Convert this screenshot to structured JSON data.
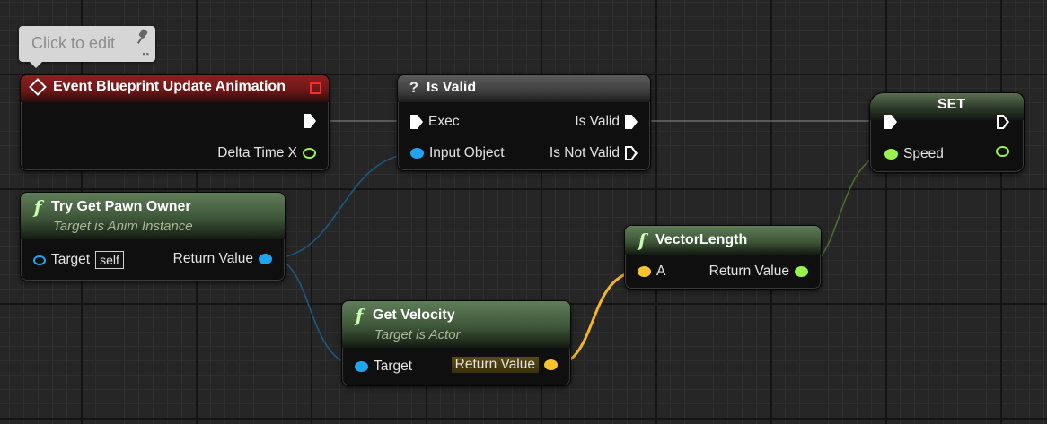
{
  "tooltip": {
    "text": "Click to edit"
  },
  "nodes": {
    "event": {
      "title": "Event Blueprint Update Animation",
      "output": "Delta Time X"
    },
    "is_valid": {
      "title": "Is Valid",
      "exec_in": "Exec",
      "input": "Input Object",
      "out_valid": "Is Valid",
      "out_not_valid": "Is Not Valid"
    },
    "try_get_pawn": {
      "title": "Try Get Pawn Owner",
      "subtitle": "Target is Anim Instance",
      "input": "Target",
      "input_default": "self",
      "output": "Return Value"
    },
    "get_velocity": {
      "title": "Get Velocity",
      "subtitle": "Target is Actor",
      "input": "Target",
      "output": "Return Value"
    },
    "vector_length": {
      "title": "VectorLength",
      "input": "A",
      "output": "Return Value"
    },
    "set": {
      "title": "SET",
      "input": "Speed"
    }
  },
  "colors": {
    "object_pin": "#22a3f0",
    "float_pin": "#9cf24c",
    "vector_pin": "#f7c22c",
    "event_header": "#8e2020",
    "function_header": "#5f7d59"
  }
}
